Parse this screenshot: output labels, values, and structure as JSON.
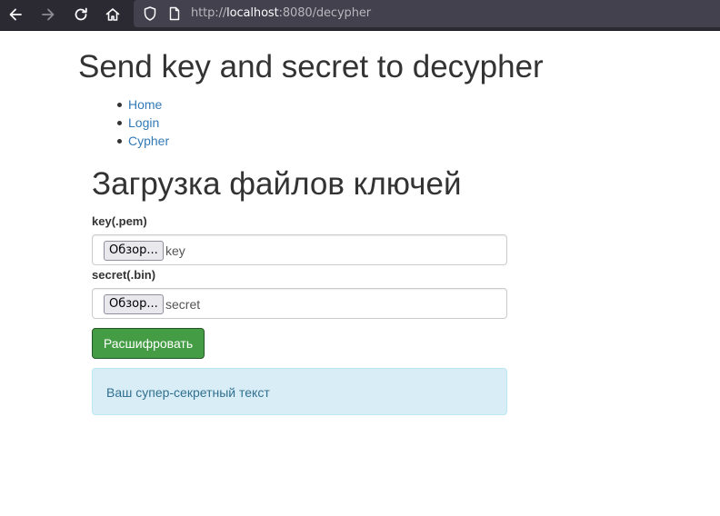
{
  "browser": {
    "url_prefix": "http://",
    "url_host": "localhost",
    "url_rest": ":8080/decypher"
  },
  "page": {
    "title": "Send key and secret to decypher",
    "nav": [
      {
        "label": "Home"
      },
      {
        "label": "Login"
      },
      {
        "label": "Cypher"
      }
    ],
    "section_title": "Загрузка файлов ключей",
    "key_field": {
      "label": "key(.pem)",
      "button": "Обзор...",
      "file": "key"
    },
    "secret_field": {
      "label": "secret(.bin)",
      "button": "Обзор...",
      "file": "secret"
    },
    "submit_label": "Расшифровать",
    "result_text": "Ваш супер-секретный текст"
  },
  "colors": {
    "link": "#337ab7",
    "success": "#449d44",
    "info_bg": "#d9edf7",
    "info_text": "#31708f",
    "chrome_bg": "#2b2a33"
  }
}
